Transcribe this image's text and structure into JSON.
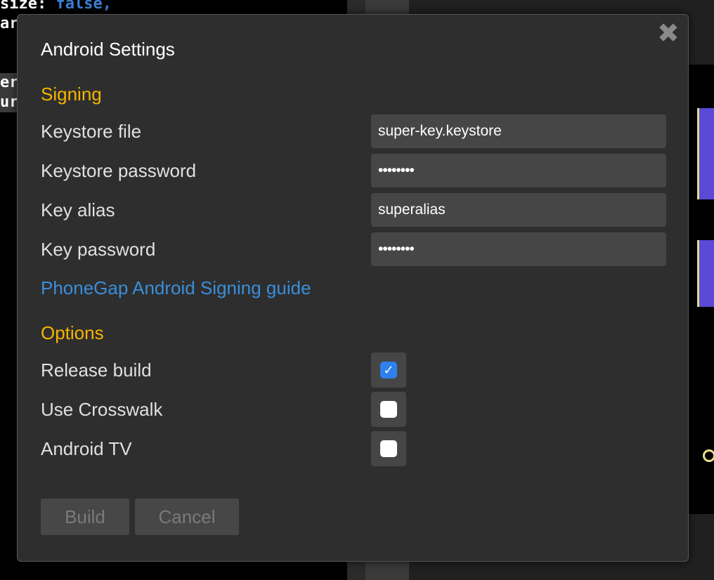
{
  "background": {
    "code_lines": [
      {
        "text": "size: ",
        "keyword": "false,"
      },
      {
        "text": "ar",
        "keyword": ""
      }
    ],
    "highlight_lines": [
      "er",
      "ur"
    ]
  },
  "dialog": {
    "title": "Android Settings",
    "close_icon": "close-icon",
    "sections": {
      "signing": {
        "heading": "Signing",
        "fields": [
          {
            "label": "Keystore file",
            "value": "super-key.keystore",
            "type": "text"
          },
          {
            "label": "Keystore password",
            "value": "••••••••",
            "type": "password"
          },
          {
            "label": "Key alias",
            "value": "superalias",
            "type": "text"
          },
          {
            "label": "Key password",
            "value": "••••••••",
            "type": "password"
          }
        ],
        "guide_link": "PhoneGap Android Signing guide"
      },
      "options": {
        "heading": "Options",
        "checkboxes": [
          {
            "label": "Release build",
            "checked": true
          },
          {
            "label": "Use Crosswalk",
            "checked": false
          },
          {
            "label": "Android TV",
            "checked": false
          }
        ]
      }
    },
    "buttons": {
      "build": "Build",
      "cancel": "Cancel"
    }
  },
  "colors": {
    "section_heading": "#f6b400",
    "link": "#3a8edb",
    "checkbox_checked": "#2f80ed",
    "dialog_bg": "#2e2e2e",
    "field_bg": "#464646"
  }
}
